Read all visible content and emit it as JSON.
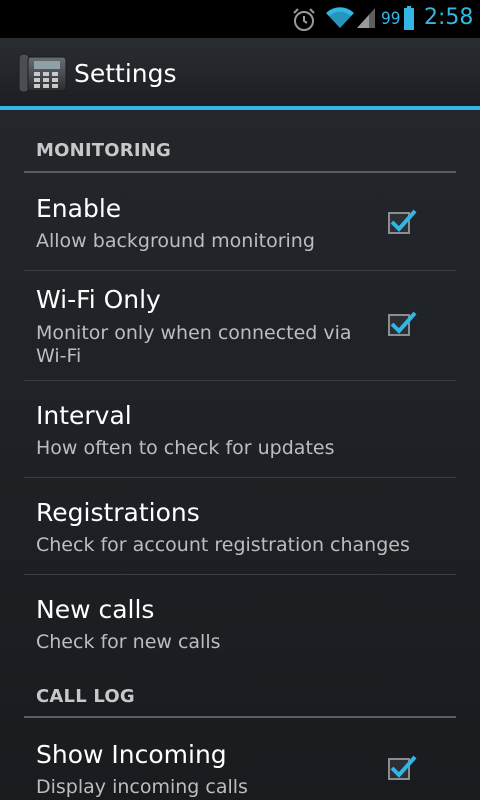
{
  "status_bar": {
    "battery_percent": "99",
    "time": "2:58",
    "icons": [
      "alarm-icon",
      "wifi-icon",
      "signal-icon",
      "battery-icon"
    ],
    "accent": "#33b5e5"
  },
  "action_bar": {
    "title": "Settings",
    "app_icon": "phone-icon"
  },
  "sections": [
    {
      "title": "MONITORING",
      "items": [
        {
          "title": "Enable",
          "summary": "Allow background monitoring",
          "checked": true
        },
        {
          "title": "Wi-Fi Only",
          "summary": "Monitor only when connected via Wi-Fi",
          "checked": true
        },
        {
          "title": "Interval",
          "summary": "How often to check for updates"
        },
        {
          "title": "Registrations",
          "summary": "Check for account registration changes"
        },
        {
          "title": "New calls",
          "summary": "Check for new calls"
        }
      ]
    },
    {
      "title": "CALL LOG",
      "items": [
        {
          "title": "Show Incoming",
          "summary": "Display incoming calls",
          "checked": true
        }
      ]
    }
  ],
  "colors": {
    "accent": "#33b5e5",
    "background": "#1f2227"
  }
}
